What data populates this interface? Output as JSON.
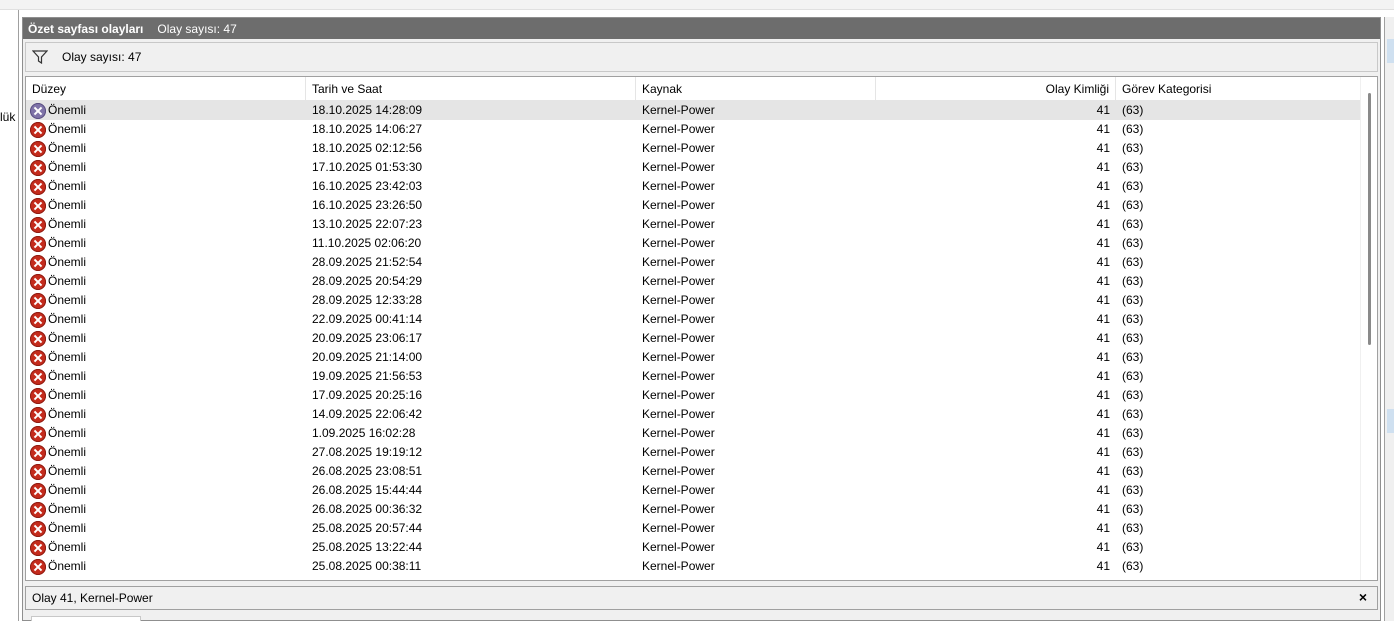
{
  "left_fragment_text": "lük",
  "panel": {
    "title": "Özet sayfası olayları",
    "title_count": "Olay sayısı: 47",
    "filter_count": "Olay sayısı: 47"
  },
  "columns": [
    "Düzey",
    "Tarih ve Saat",
    "Kaynak",
    "Olay Kimliği",
    "Görev Kategorisi"
  ],
  "rows": [
    {
      "level": "Önemli",
      "datetime": "18.10.2025 14:28:09",
      "source": "Kernel-Power",
      "event_id": "41",
      "category": "(63)"
    },
    {
      "level": "Önemli",
      "datetime": "18.10.2025 14:06:27",
      "source": "Kernel-Power",
      "event_id": "41",
      "category": "(63)"
    },
    {
      "level": "Önemli",
      "datetime": "18.10.2025 02:12:56",
      "source": "Kernel-Power",
      "event_id": "41",
      "category": "(63)"
    },
    {
      "level": "Önemli",
      "datetime": "17.10.2025 01:53:30",
      "source": "Kernel-Power",
      "event_id": "41",
      "category": "(63)"
    },
    {
      "level": "Önemli",
      "datetime": "16.10.2025 23:42:03",
      "source": "Kernel-Power",
      "event_id": "41",
      "category": "(63)"
    },
    {
      "level": "Önemli",
      "datetime": "16.10.2025 23:26:50",
      "source": "Kernel-Power",
      "event_id": "41",
      "category": "(63)"
    },
    {
      "level": "Önemli",
      "datetime": "13.10.2025 22:07:23",
      "source": "Kernel-Power",
      "event_id": "41",
      "category": "(63)"
    },
    {
      "level": "Önemli",
      "datetime": "11.10.2025 02:06:20",
      "source": "Kernel-Power",
      "event_id": "41",
      "category": "(63)"
    },
    {
      "level": "Önemli",
      "datetime": "28.09.2025 21:52:54",
      "source": "Kernel-Power",
      "event_id": "41",
      "category": "(63)"
    },
    {
      "level": "Önemli",
      "datetime": "28.09.2025 20:54:29",
      "source": "Kernel-Power",
      "event_id": "41",
      "category": "(63)"
    },
    {
      "level": "Önemli",
      "datetime": "28.09.2025 12:33:28",
      "source": "Kernel-Power",
      "event_id": "41",
      "category": "(63)"
    },
    {
      "level": "Önemli",
      "datetime": "22.09.2025 00:41:14",
      "source": "Kernel-Power",
      "event_id": "41",
      "category": "(63)"
    },
    {
      "level": "Önemli",
      "datetime": "20.09.2025 23:06:17",
      "source": "Kernel-Power",
      "event_id": "41",
      "category": "(63)"
    },
    {
      "level": "Önemli",
      "datetime": "20.09.2025 21:14:00",
      "source": "Kernel-Power",
      "event_id": "41",
      "category": "(63)"
    },
    {
      "level": "Önemli",
      "datetime": "19.09.2025 21:56:53",
      "source": "Kernel-Power",
      "event_id": "41",
      "category": "(63)"
    },
    {
      "level": "Önemli",
      "datetime": "17.09.2025 20:25:16",
      "source": "Kernel-Power",
      "event_id": "41",
      "category": "(63)"
    },
    {
      "level": "Önemli",
      "datetime": "14.09.2025 22:06:42",
      "source": "Kernel-Power",
      "event_id": "41",
      "category": "(63)"
    },
    {
      "level": "Önemli",
      "datetime": "1.09.2025 16:02:28",
      "source": "Kernel-Power",
      "event_id": "41",
      "category": "(63)"
    },
    {
      "level": "Önemli",
      "datetime": "27.08.2025 19:19:12",
      "source": "Kernel-Power",
      "event_id": "41",
      "category": "(63)"
    },
    {
      "level": "Önemli",
      "datetime": "26.08.2025 23:08:51",
      "source": "Kernel-Power",
      "event_id": "41",
      "category": "(63)"
    },
    {
      "level": "Önemli",
      "datetime": "26.08.2025 15:44:44",
      "source": "Kernel-Power",
      "event_id": "41",
      "category": "(63)"
    },
    {
      "level": "Önemli",
      "datetime": "26.08.2025 00:36:32",
      "source": "Kernel-Power",
      "event_id": "41",
      "category": "(63)"
    },
    {
      "level": "Önemli",
      "datetime": "25.08.2025 20:57:44",
      "source": "Kernel-Power",
      "event_id": "41",
      "category": "(63)"
    },
    {
      "level": "Önemli",
      "datetime": "25.08.2025 13:22:44",
      "source": "Kernel-Power",
      "event_id": "41",
      "category": "(63)"
    },
    {
      "level": "Önemli",
      "datetime": "25.08.2025 00:38:11",
      "source": "Kernel-Power",
      "event_id": "41",
      "category": "(63)"
    }
  ],
  "detail": {
    "title": "Olay 41, Kernel-Power",
    "close_glyph": "×"
  },
  "icons": {
    "filter": "funnel-icon",
    "level": "critical-error-icon",
    "close": "close-icon"
  },
  "colors": {
    "title_bar": "#6d6d6d",
    "error_icon": "#c42b1c",
    "selected_row": "#e5e5e5"
  }
}
